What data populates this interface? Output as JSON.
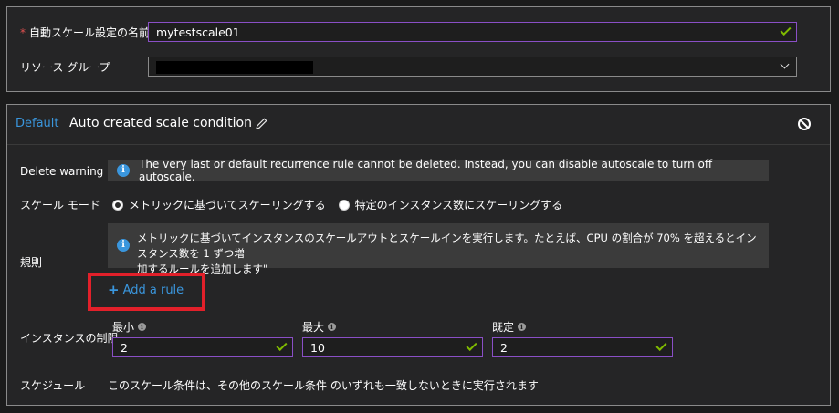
{
  "top": {
    "name_label": "自動スケール設定の名前",
    "required_mark": "*",
    "name_value": "mytestscale01",
    "resource_group_label": "リソース グループ"
  },
  "condition": {
    "default_label": "Default",
    "name": "Auto created scale condition",
    "delete_warning_label": "Delete warning",
    "delete_warning_text": "The very last or default recurrence rule cannot be deleted. Instead, you can disable autoscale to turn off autoscale.",
    "scale_mode_label": "スケール モード",
    "scale_mode_options": [
      {
        "label": "メトリックに基づいてスケーリングする",
        "selected": true
      },
      {
        "label": "特定のインスタンス数にスケーリングする",
        "selected": false
      }
    ],
    "rules_label": "規則",
    "rules_info_line1": "メトリックに基づいてインスタンスのスケールアウトとスケールインを実行します。たとえば、CPU の割合が 70% を超えるとインスタンス数を 1 ずつ増",
    "rules_info_line2": "加するルールを追加します\"",
    "add_rule": "Add a rule",
    "instance_limits_label": "インスタンスの制限",
    "min_label": "最小",
    "min_value": "2",
    "max_label": "最大",
    "max_value": "10",
    "default_count_label": "既定",
    "default_count_value": "2",
    "schedule_label": "スケジュール",
    "schedule_text": "このスケール条件は、その他のスケール条件 のいずれも一致しないときに実行されます"
  },
  "colors": {
    "accent_blue": "#3a96dd",
    "focus_purple": "#8a4fc6",
    "valid_green": "#7fba00",
    "highlight_red": "#e2202a"
  },
  "icons": [
    "check-icon",
    "chevron-down-icon",
    "edit-pencil-icon",
    "disable-icon",
    "info-icon",
    "plus-icon"
  ]
}
